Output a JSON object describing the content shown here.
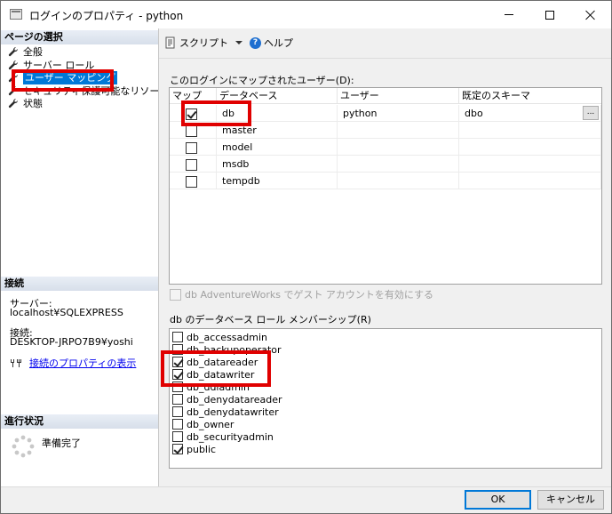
{
  "window": {
    "title": "ログインのプロパティ - python"
  },
  "left": {
    "page_select_header": "ページの選択",
    "items": [
      {
        "label": "全般"
      },
      {
        "label": "サーバー ロール"
      },
      {
        "label": "ユーザー マッピング",
        "selected": true
      },
      {
        "label": "セキュリティ保護可能なリソース"
      },
      {
        "label": "状態"
      }
    ],
    "connection_header": "接続",
    "server_label": "サーバー:",
    "server_value": "localhost¥SQLEXPRESS",
    "connection_label": "接続:",
    "connection_value": "DESKTOP-JRPO7B9¥yoshi",
    "connection_props_link": "接続のプロパティの表示",
    "progress_header": "進行状況",
    "progress_status": "準備完了"
  },
  "toolbar": {
    "script_label": "スクリプト",
    "help_label": "ヘルプ",
    "help_glyph": "?"
  },
  "mapping": {
    "caption": "このログインにマップされたユーザー(D):",
    "columns": [
      "マップ",
      "データベース",
      "ユーザー",
      "既定のスキーマ"
    ],
    "rows": [
      {
        "mapped": true,
        "database": "db",
        "user": "python",
        "schema": "dbo",
        "ellipsis": "..."
      },
      {
        "mapped": false,
        "database": "master",
        "user": "",
        "schema": ""
      },
      {
        "mapped": false,
        "database": "model",
        "user": "",
        "schema": ""
      },
      {
        "mapped": false,
        "database": "msdb",
        "user": "",
        "schema": ""
      },
      {
        "mapped": false,
        "database": "tempdb",
        "user": "",
        "schema": ""
      }
    ]
  },
  "guest": {
    "label": "db AdventureWorks でゲスト アカウントを有効にする"
  },
  "roles": {
    "caption": "db のデータベース ロール メンバーシップ(R)",
    "items": [
      {
        "name": "db_accessadmin",
        "checked": false
      },
      {
        "name": "db_backupoperator",
        "checked": false
      },
      {
        "name": "db_datareader",
        "checked": true
      },
      {
        "name": "db_datawriter",
        "checked": true
      },
      {
        "name": "db_ddladmin",
        "checked": false
      },
      {
        "name": "db_denydatareader",
        "checked": false
      },
      {
        "name": "db_denydatawriter",
        "checked": false
      },
      {
        "name": "db_owner",
        "checked": false
      },
      {
        "name": "db_securityadmin",
        "checked": false
      },
      {
        "name": "public",
        "checked": true
      }
    ]
  },
  "buttons": {
    "ok": "OK",
    "cancel": "キャンセル"
  },
  "colors": {
    "highlight_box": "#e00000",
    "selection": "#0078d7"
  }
}
